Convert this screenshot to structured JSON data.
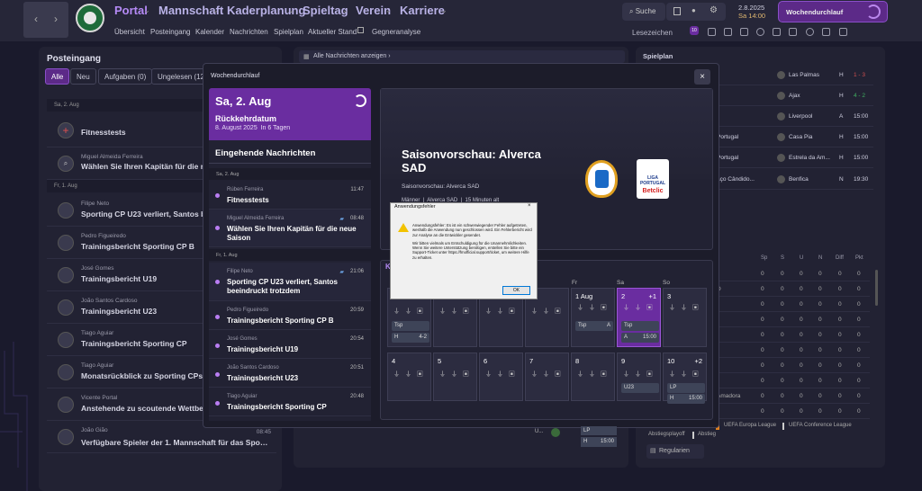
{
  "topbar": {
    "menu": [
      {
        "label": "Portal"
      },
      {
        "label": "Mannschaft"
      },
      {
        "label": "Kaderplanung"
      },
      {
        "label": "Spieltag"
      },
      {
        "label": "Verein"
      },
      {
        "label": "Karriere"
      }
    ],
    "subnav": [
      "Übersicht",
      "Posteingang",
      "Kalender",
      "Nachrichten",
      "Spielplan",
      "Aktueller Stand",
      "Gegneranalyse"
    ],
    "search_label": "Suche",
    "date_line1": "2.8.2025",
    "date_line2_day": "Sa",
    "date_line2_time": "14:00",
    "continue_label": "Wochendurchlauf",
    "bookmarks_label": "Lesezeichen",
    "bookmarks_badge": "10"
  },
  "inbox": {
    "title": "Posteingang",
    "filters": [
      "Alle",
      "Neu",
      "Aufgaben (0)",
      "Ungelesen (12)"
    ],
    "date1": "Sa, 2. Aug",
    "date2": "Fr, 1. Aug",
    "items": [
      {
        "sender": "",
        "title": "Fitnesstests",
        "time": ""
      },
      {
        "sender": "Miguel Almeida Ferreira",
        "title": "Wählen Sie Ihren Kapitän für die neue Saison",
        "time": ""
      },
      {
        "sender": "Filipe Neto",
        "title": "Sporting CP U23 verliert, Santos beeindruckt trotzdem",
        "time": ""
      },
      {
        "sender": "Pedro Figueiredo",
        "title": "Trainingsbericht Sporting CP B",
        "time": ""
      },
      {
        "sender": "José Gomes",
        "title": "Trainingsbericht U19",
        "time": ""
      },
      {
        "sender": "João Santos Cardoso",
        "title": "Trainingsbericht U23",
        "time": ""
      },
      {
        "sender": "Tiago Aguiar",
        "title": "Trainingsbericht Sporting CP",
        "time": ""
      },
      {
        "sender": "Tiago Aguiar",
        "title": "Monatsrückblick zu Sporting CPs Neuzugängen",
        "time": ""
      },
      {
        "sender": "Vicente Portal",
        "title": "Anstehende zu scoutende Wettbewerbe",
        "time": ""
      },
      {
        "sender": "João Gião",
        "title": "Verfügbare Spieler der 1. Mannschaft für das Sporting CP-Spiel",
        "time": "08:45"
      }
    ]
  },
  "center": {
    "all_messages": "Alle Nachrichten anzeigen"
  },
  "spielplan": {
    "title": "Spielplan",
    "rows": [
      {
        "prefix": "",
        "team": "Las Palmas",
        "ha": "H",
        "result": "1 - 3",
        "color": "#d05050"
      },
      {
        "prefix": "",
        "team": "Ajax",
        "ha": "H",
        "result": "4 - 2",
        "color": "#40b060"
      },
      {
        "prefix": "",
        "team": "Liverpool",
        "ha": "A",
        "result": "15:00",
        "color": "#cfcfe0"
      },
      {
        "prefix": "Portugal",
        "team": "Casa Pia",
        "ha": "H",
        "result": "15:00",
        "color": "#cfcfe0"
      },
      {
        "prefix": "Portugal",
        "team": "Estrela da Am...",
        "ha": "H",
        "result": "15:00",
        "color": "#cfcfe0"
      },
      {
        "prefix": "aço Cândido...",
        "team": "Benfica",
        "ha": "N",
        "result": "19:30",
        "color": "#cfcfe0"
      }
    ],
    "table_headers": [
      "Sp",
      "S",
      "U",
      "N",
      "Diff",
      "Pkt"
    ],
    "table_rows": [
      {
        "team": "",
        "vals": [
          "0",
          "0",
          "0",
          "0",
          "0",
          "0"
        ]
      },
      {
        "team": "D",
        "vals": [
          "0",
          "0",
          "0",
          "0",
          "0",
          "0"
        ]
      },
      {
        "team": "",
        "vals": [
          "0",
          "0",
          "0",
          "0",
          "0",
          "0"
        ]
      },
      {
        "team": "",
        "vals": [
          "0",
          "0",
          "0",
          "0",
          "0",
          "0"
        ]
      },
      {
        "team": "",
        "vals": [
          "0",
          "0",
          "0",
          "0",
          "0",
          "0"
        ]
      },
      {
        "team": "",
        "vals": [
          "0",
          "0",
          "0",
          "0",
          "0",
          "0"
        ]
      },
      {
        "team": "",
        "vals": [
          "0",
          "0",
          "0",
          "0",
          "0",
          "0"
        ]
      },
      {
        "team": "",
        "vals": [
          "0",
          "0",
          "0",
          "0",
          "0",
          "0"
        ]
      },
      {
        "team": "Amadora",
        "vals": [
          "0",
          "0",
          "0",
          "0",
          "0",
          "0"
        ]
      },
      {
        "team": "",
        "vals": [
          "0",
          "0",
          "0",
          "0",
          "0",
          "0"
        ]
      }
    ],
    "legend1": "UEFA Europa League",
    "legend2": "UEFA Conference League",
    "legend3": "Abstiegsplayoff",
    "legend4": "Abstieg",
    "rules_button": "Regularien"
  },
  "modal": {
    "title": "Wochendurchlauf",
    "big_date": "Sa, 2. Aug",
    "return_title": "Rückkehrdatum",
    "return_date": "8. August 2025",
    "return_in": "In 6 Tagen",
    "incoming": "Eingehende Nachrichten",
    "date1": "Sa, 2. Aug",
    "date2": "Fr, 1. Aug",
    "messages": [
      {
        "sender": "Rúben Ferreira",
        "title": "Fitnesstests",
        "time": "11:47"
      },
      {
        "sender": "Miguel Almeida Ferreira",
        "title": "Wählen Sie Ihren Kapitän für die neue Saison",
        "time": "08:48"
      },
      {
        "sender": "Filipe Neto",
        "title": "Sporting CP U23 verliert, Santos beeindruckt trotzdem",
        "time": "21:06"
      },
      {
        "sender": "Pedro Figueiredo",
        "title": "Trainingsbericht Sporting CP B",
        "time": "20:59"
      },
      {
        "sender": "José Gomes",
        "title": "Trainingsbericht U19",
        "time": "20:54"
      },
      {
        "sender": "João Santos Cardoso",
        "title": "Trainingsbericht U23",
        "time": "20:51"
      },
      {
        "sender": "Tiago Aguiar",
        "title": "Trainingsbericht Sporting CP",
        "time": "20:48"
      }
    ],
    "news": {
      "title": "Saisonvorschau: Alverca SAD",
      "subtitle": "Saisonvorschau: Alverca SAD",
      "meta1": "Männer",
      "meta2": "Alverca SAD",
      "meta3": "15 Minuten alt",
      "league_line1": "LIGA PORTUGAL",
      "league_line2": "Betclic"
    },
    "calendar": {
      "title": "Ka",
      "day_headers": [
        "Fr",
        "Sa",
        "So"
      ],
      "week1": [
        {
          "num": "",
          "chip1": "Tsp",
          "chip2": "H",
          "chip2r": "4-2"
        },
        {
          "num": ""
        },
        {
          "num": ""
        },
        {
          "num": ""
        },
        {
          "num": "1 Aug",
          "chip1": "Tsp",
          "chip1r": "A"
        },
        {
          "num": "2",
          "extra": "+1",
          "chip1": "Tsp",
          "chip2": "A",
          "chip2r": "15:00"
        },
        {
          "num": "3"
        }
      ],
      "week2": [
        {
          "num": "4"
        },
        {
          "num": "5"
        },
        {
          "num": "6"
        },
        {
          "num": "7"
        },
        {
          "num": "8"
        },
        {
          "num": "9",
          "chip1": "U23"
        },
        {
          "num": "10",
          "extra": "+2",
          "chip1": "LP",
          "chip2": "H",
          "chip2r": "15:00"
        }
      ]
    },
    "bottom_chip1": "U...",
    "bottom_chip2": "LP",
    "bottom_chip3": "H",
    "bottom_chip3r": "15:00"
  },
  "error": {
    "title": "Anwendungsfehler",
    "close": "×",
    "body1": "Anwendungsfehler: Es ist ein schwerwiegender Fehler aufgetreten, weshalb die Anwendung nun geschlossen wird. Ein Fehlerbericht wird zur Analyse an die Entwickler gesendet.",
    "body2": "Wir bitten vielmals um Entschuldigung für die Unannehmlichkeiten. Wenn Sie weitere Unterstützung benötigen, erstellen Sie bitte ein Support-Ticket unter https://fmofficial.support/ticket, um weitere Hilfe zu erhalten.",
    "ok": "OK"
  },
  "colors": {
    "accent": "#6a2da0",
    "accent_light": "#b58af6",
    "win": "#40b060",
    "loss": "#d05050"
  }
}
